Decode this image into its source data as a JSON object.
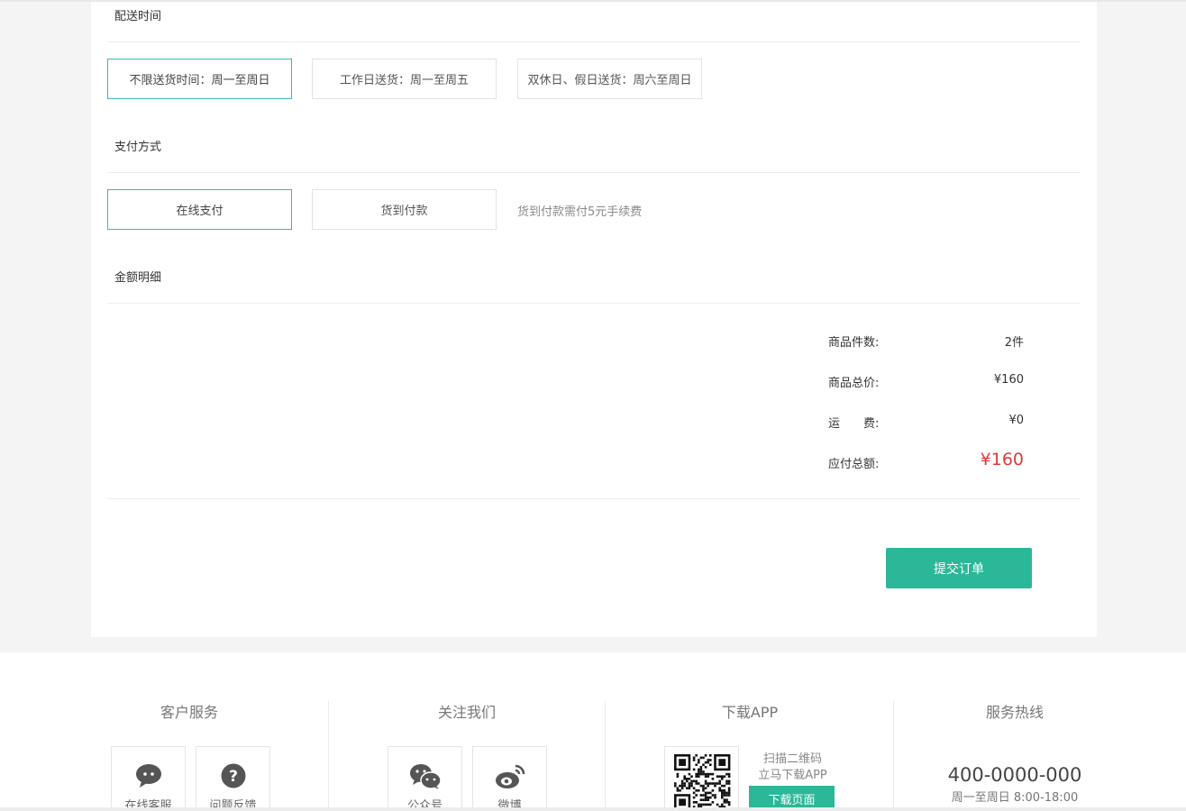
{
  "delivery": {
    "title": "配送时间",
    "options": [
      {
        "label": "不限送货时间：周一至周日",
        "selected": true
      },
      {
        "label": "工作日送货：周一至周五",
        "selected": false
      },
      {
        "label": "双休日、假日送货：周六至周日",
        "selected": false
      }
    ]
  },
  "payment": {
    "title": "支付方式",
    "options": [
      {
        "label": "在线支付",
        "selected": true
      },
      {
        "label": "货到付款",
        "selected": false
      }
    ],
    "note": "货到付款需付5元手续费"
  },
  "amount": {
    "title": "金额明细",
    "rows": [
      {
        "label": "商品件数:",
        "value": "2件"
      },
      {
        "label": "商品总价:",
        "value": "¥160"
      },
      {
        "label": "运　　费:",
        "value": "¥0"
      },
      {
        "label": "应付总额:",
        "value": "¥160"
      }
    ]
  },
  "submit_label": "提交订单",
  "footer": {
    "customer_service": {
      "title": "客户服务",
      "items": [
        {
          "label": "在线客服",
          "icon": "chat-bubble-icon"
        },
        {
          "label": "问题反馈",
          "icon": "question-icon"
        }
      ]
    },
    "follow_us": {
      "title": "关注我们",
      "items": [
        {
          "label": "公众号",
          "icon": "wechat-icon"
        },
        {
          "label": "微博",
          "icon": "weibo-icon"
        }
      ]
    },
    "download": {
      "title": "下载APP",
      "scan_text": "扫描二维码",
      "download_text": "立马下载APP",
      "button_label": "下载页面"
    },
    "hotline": {
      "title": "服务热线",
      "number": "400-0000-000",
      "hours": "周一至周日 8:00-18:00"
    }
  },
  "colors": {
    "accent": "#2bb898",
    "selected_border": "#3cb6b0",
    "total_price": "#e03a3a",
    "icon": "#555555"
  }
}
